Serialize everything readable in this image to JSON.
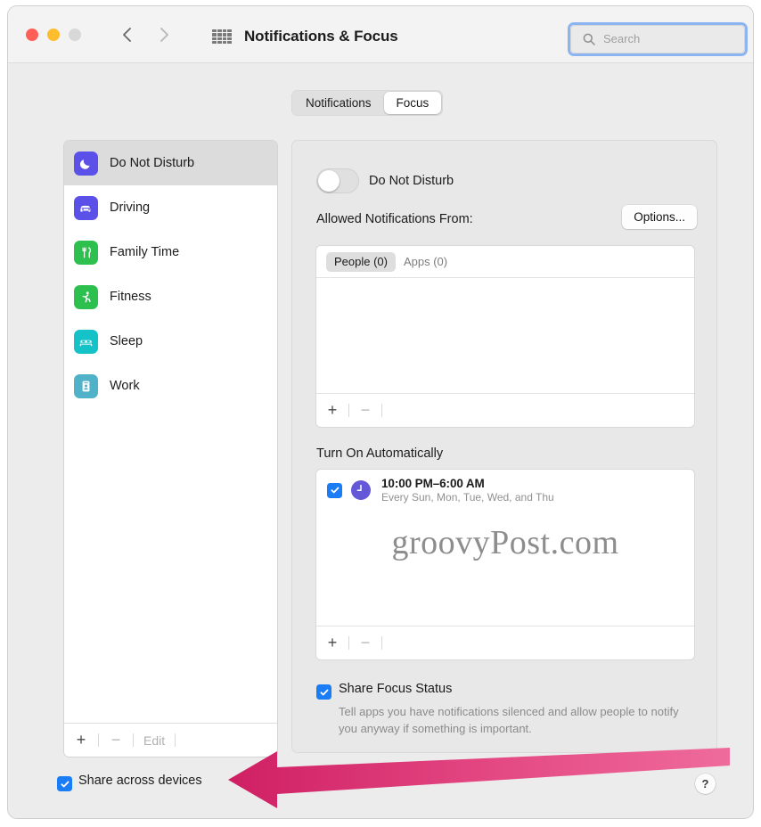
{
  "window": {
    "title": "Notifications & Focus",
    "traffic_lights": [
      "close",
      "minimize",
      "maximize"
    ],
    "nav": {
      "back_icon": "chevron-left-icon",
      "forward_icon": "chevron-right-icon",
      "grid_icon": "grid-view-icon"
    }
  },
  "search": {
    "placeholder": "Search",
    "value": "",
    "icon": "search-icon"
  },
  "tabs": [
    {
      "label": "Notifications",
      "active": false
    },
    {
      "label": "Focus",
      "active": true
    }
  ],
  "sidebar": {
    "items": [
      {
        "label": "Do Not Disturb",
        "icon": "moon-icon",
        "color": "#5b50e8",
        "selected": true
      },
      {
        "label": "Driving",
        "icon": "car-icon",
        "color": "#5b50e8",
        "selected": false
      },
      {
        "label": "Family Time",
        "icon": "cutlery-icon",
        "color": "#2dc04f",
        "selected": false
      },
      {
        "label": "Fitness",
        "icon": "runner-icon",
        "color": "#2dc04f",
        "selected": false
      },
      {
        "label": "Sleep",
        "icon": "bed-icon",
        "color": "#14c2c8",
        "selected": false
      },
      {
        "label": "Work",
        "icon": "badge-icon",
        "color": "#4fb2c9",
        "selected": false
      }
    ],
    "toolbar": {
      "add": "+",
      "remove": "−",
      "edit": "Edit"
    }
  },
  "detail": {
    "toggle": {
      "label": "Do Not Disturb",
      "on": false
    },
    "allowed": {
      "label": "Allowed Notifications From:",
      "options_button": "Options...",
      "tabs": [
        {
          "label": "People (0)",
          "active": true
        },
        {
          "label": "Apps (0)",
          "active": false
        }
      ],
      "toolbar": {
        "add": "+",
        "remove": "−"
      }
    },
    "turn_on": {
      "label": "Turn On Automatically",
      "schedule": {
        "checked": true,
        "icon": "clock-icon",
        "time": "10:00 PM–6:00 AM",
        "days": "Every Sun, Mon, Tue, Wed, and Thu"
      },
      "watermark": "groovyPost.com",
      "toolbar": {
        "add": "+",
        "remove": "−"
      }
    },
    "share_status": {
      "checked": true,
      "label": "Share Focus Status",
      "description": "Tell apps you have notifications silenced and allow people to notify you anyway if something is important."
    }
  },
  "bottom": {
    "share_across_devices": {
      "checked": true,
      "label": "Share across devices"
    },
    "help_button": "?"
  },
  "annotation": {
    "type": "arrow",
    "color": "#d62a6e",
    "direction": "left"
  },
  "colors": {
    "accent_blue": "#1b7df5",
    "focus_ring": "#8cb4f0",
    "annotation_pink": "#d62a6e",
    "window_bg": "#ececec",
    "panel_bg": "#e8e8e8"
  }
}
